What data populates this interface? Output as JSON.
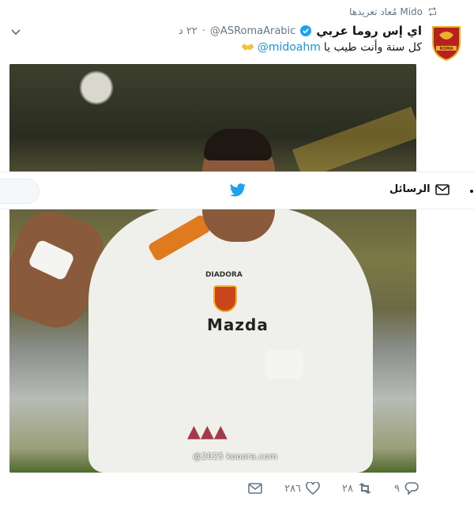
{
  "retweet": {
    "label": "Mido مُعاد تغريدها"
  },
  "account": {
    "display_name": "اي إس روما عربي",
    "handle": "@ASRomaArabic",
    "timestamp": "٢٢ د"
  },
  "tweet": {
    "text": "كل سنة وأنت طيب يا",
    "mention": "@midoahm",
    "emoji": "👐"
  },
  "media": {
    "kit_brand": "DIADORA",
    "sponsor": "Mazda",
    "watermark": "@2025 kooora.com"
  },
  "overlay": {
    "messages_label": "الرسائل"
  },
  "actions": {
    "replies": "٩",
    "retweets": "٢٨",
    "likes": "٢٨٦"
  },
  "colors": {
    "accent": "#1da1f2",
    "mention": "#1b95e0",
    "muted": "#657786"
  }
}
